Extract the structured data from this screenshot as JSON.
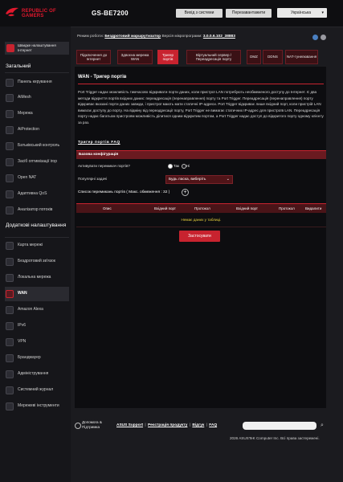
{
  "header": {
    "brand_line1": "REPUBLIC OF",
    "brand_line2": "GAMERS",
    "model": "GS-BE7200",
    "logout_label": "Вихід з системи",
    "reboot_label": "Перезавантажити",
    "language": "Українська"
  },
  "sidebar": {
    "setup_label": "Швидке налаштування Інтернет",
    "general_heading": "Загальний",
    "general_items": [
      {
        "label": "Панель керування",
        "icon": "dashboard-icon"
      },
      {
        "label": "AiMesh",
        "icon": "mesh-icon"
      },
      {
        "label": "Мережа",
        "icon": "network-icon"
      },
      {
        "label": "AiProtection",
        "icon": "shield-icon"
      },
      {
        "label": "Батьківський контроль",
        "icon": "parental-icon"
      },
      {
        "label": "Засіб оптимізації ігор",
        "icon": "gamepad-icon"
      },
      {
        "label": "Open NAT",
        "icon": "open-nat-icon"
      },
      {
        "label": "Адаптивна QoS",
        "icon": "qos-icon"
      },
      {
        "label": "Аналізатор потоків",
        "icon": "traffic-analyzer-icon"
      }
    ],
    "advanced_heading": "Додаткові налаштування",
    "advanced_items": [
      {
        "label": "Карта мережі",
        "icon": "network-map-icon"
      },
      {
        "label": "Бездротовий зв'язок",
        "icon": "wireless-icon"
      },
      {
        "label": "Локальна мережа",
        "icon": "lan-icon"
      },
      {
        "label": "WAN",
        "icon": "globe-icon"
      },
      {
        "label": "Amazon Alexa",
        "icon": "alexa-icon"
      },
      {
        "label": "IPv6",
        "icon": "ipv6-icon"
      },
      {
        "label": "VPN",
        "icon": "vpn-icon"
      },
      {
        "label": "Брандмауер",
        "icon": "firewall-icon"
      },
      {
        "label": "Адміністрування",
        "icon": "admin-icon"
      },
      {
        "label": "Системний журнал",
        "icon": "log-icon"
      },
      {
        "label": "Мережеві інструменти",
        "icon": "tools-icon"
      }
    ]
  },
  "mode_line": {
    "prefix": "Режим роботи:",
    "mode": "Бездротовий маршрутизатор",
    "fw_prefix": "Версія мікропрограми:",
    "fw": "3.0.0.6.102_38883"
  },
  "tabs": [
    "Підключення до Інтернет",
    "Здвоєна мережа WAN",
    "Тригер портів",
    "Віртуальний сервер / Переадресація порту",
    "DMZ",
    "DDNS",
    "NAT-тунелювання"
  ],
  "content": {
    "title": "WAN - Тригер портів",
    "description": "Port Trigger надає можливість тимчасово відкривати порти даних, коли пристрої LAN потребують необмеженого доступу до Інтернет. Є два методи відкриття портів вхідних даних: переадресація (перенаправлення) порту та Port Trigger. Переадресація (перенаправлення) порту відкриває вказані порти даних завжди, і пристрої мають мати статичні IP-адреси. Port Trigger відкриває лише вхідний порт, коли пристрій LAN вимагає доступу до порту. На відміну від переадресації порту, Port Trigger не вимагає статичних IP-адрес для пристроїв LAN. Переадресація порту надає багатьом пристроям можливість ділитися одним відкритим портом, а Port Trigger надає доступ до відкритого порту одному клієнту за раз.",
    "faq_link": "Тригер портів FAQ",
    "basic_config": "Базова конфігурація",
    "enable_label": "Активувати перемикач портів?",
    "yes_label": "Так",
    "no_label": "Ні",
    "enabled": true,
    "popular_label": "Популярні задачі",
    "popular_value": "Будь ласка, виберіть",
    "list_title": "Список перемикань портів ( Макс. обмеження : 32 )",
    "columns": [
      "Опис",
      "Вхідний порт",
      "Протокол",
      "Вхідний порт",
      "Протокол",
      "Видалити"
    ],
    "empty_text": "Немає даних у таблиці.",
    "apply_label": "Застосувати"
  },
  "footer": {
    "help_line1": "Допомога &",
    "help_line2": "Підтримка",
    "links": [
      "ASUS Support",
      "Реєстрація продукту",
      "Відгук",
      "FAQ"
    ],
    "copyright": "2026 ASUSTeK Computer Inc. Всі права застережені."
  },
  "colors": {
    "accent": "#c8232f",
    "background": "#1b1b1f",
    "empty_text": "#e8d13c"
  }
}
